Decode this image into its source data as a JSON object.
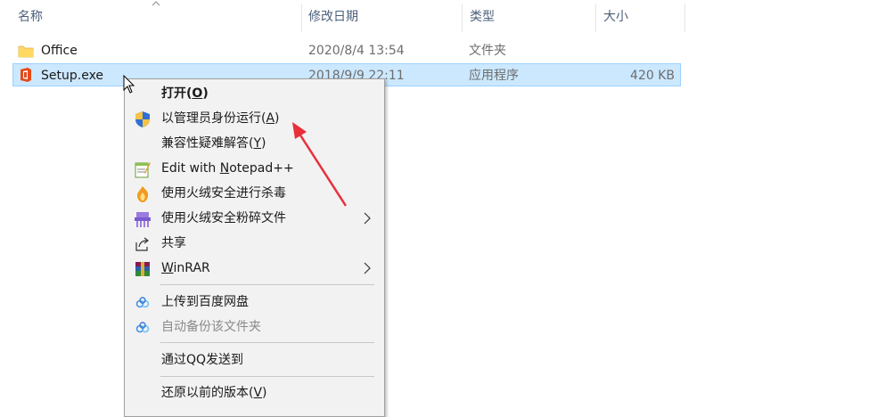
{
  "header": {
    "name": "名称",
    "date": "修改日期",
    "type": "类型",
    "size": "大小"
  },
  "files": [
    {
      "name": "Office",
      "date": "2020/8/4 13:54",
      "type": "文件夹",
      "size": "",
      "icon": "folder-icon"
    },
    {
      "name": "Setup.exe",
      "date": "2018/9/9 22:11",
      "type": "应用程序",
      "size": "420 KB",
      "icon": "office-app-icon"
    }
  ],
  "menu": {
    "open": {
      "text": "打开(",
      "key": "O",
      "end": ")"
    },
    "run_admin": {
      "text": "以管理员身份运行(",
      "key": "A",
      "end": ")"
    },
    "compat": {
      "text": "兼容性疑难解答(",
      "key": "Y",
      "end": ")"
    },
    "notepad": {
      "pre": "Edit with ",
      "key": "N",
      "post": "otepad++"
    },
    "scan": "使用火绒安全进行杀毒",
    "shred": "使用火绒安全粉碎文件",
    "share": "共享",
    "winrar": {
      "key": "W",
      "post": "inRAR"
    },
    "baidu_upload": "上传到百度网盘",
    "baidu_backup": "自动备份该文件夹",
    "qq_send": "通过QQ发送到",
    "restore": {
      "text": "还原以前的版本(",
      "key": "V",
      "end": ")"
    }
  },
  "colors": {
    "selection": "#cce8ff",
    "selection_border": "#99d1ff",
    "menu_bg": "#f2f2f2",
    "annotation_arrow": "#e8303a"
  }
}
